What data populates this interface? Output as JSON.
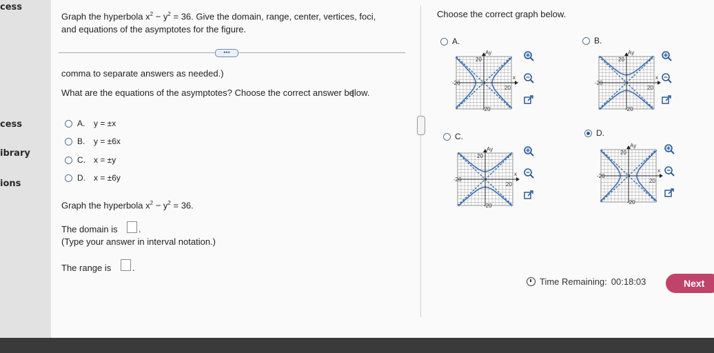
{
  "sidebar": {
    "items": [
      "cess",
      "cess",
      "ibrary",
      "ions"
    ]
  },
  "question": {
    "line1_pre": "Graph the hyperbola x",
    "line1_post": " − y",
    "line1_eq": " = 36. Give the domain, range, center, vertices, foci,",
    "line2": "and equations of the asymptotes for the figure.",
    "partial": "comma to separate answers as needed.)",
    "asymptote_prompt": "What are the equations of the asymptotes? Choose the correct answer below.",
    "options": [
      {
        "letter": "A.",
        "text": "y = ±x"
      },
      {
        "letter": "B.",
        "text": "y = ±6x"
      },
      {
        "letter": "C.",
        "text": "x = ±y"
      },
      {
        "letter": "D.",
        "text": "x = ±6y"
      }
    ],
    "graph_prompt_pre": "Graph the hyperbola x",
    "graph_prompt_mid": " − y",
    "graph_prompt_post": " = 36.",
    "exp": "2",
    "domain_label": "The domain is",
    "domain_hint": "(Type your answer in interval notation.)",
    "range_label": "The range is",
    "period": "."
  },
  "graphs_panel": {
    "prompt": "Choose the correct graph below.",
    "options": [
      {
        "letter": "A.",
        "selected": false,
        "variant": "A"
      },
      {
        "letter": "B.",
        "selected": false,
        "variant": "B"
      },
      {
        "letter": "C.",
        "selected": false,
        "variant": "C"
      },
      {
        "letter": "D.",
        "selected": true,
        "variant": "D"
      }
    ],
    "axis": {
      "y_label": "Ay",
      "x_label": "x",
      "top": "20",
      "left": "-20",
      "right": "20",
      "bottom": "-20"
    }
  },
  "footer": {
    "timer_label": "Time Remaining:",
    "timer_value": "00:18:03",
    "next_label": "Next"
  },
  "colors": {
    "accent": "#2b5b96",
    "next": "#c0446a",
    "graph_line": "#3d6fb0"
  }
}
